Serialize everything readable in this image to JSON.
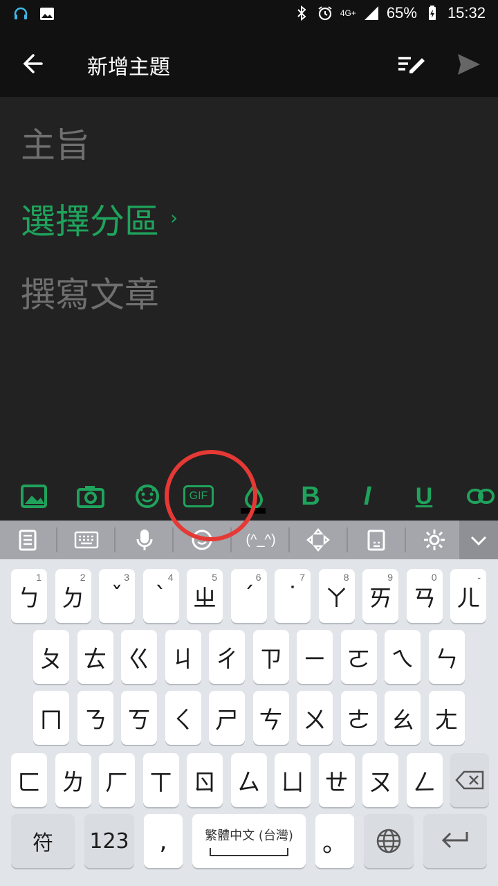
{
  "status_bar": {
    "battery": "65%",
    "time": "15:32",
    "network": "4G+"
  },
  "app_bar": {
    "title": "新增主題"
  },
  "content": {
    "subject_placeholder": "主旨",
    "section_label": "選擇分區",
    "section_chevron": "›",
    "compose_placeholder": "撰寫文章"
  },
  "toolbar": {
    "gif_label": "GIF",
    "bold_label": "B",
    "italic_label": "I",
    "underline_label": "U"
  },
  "keyboard_top": {
    "kaomoji_label": "(^_^)"
  },
  "keyboard": {
    "row1": [
      {
        "char": "ㄅ",
        "hint": "1"
      },
      {
        "char": "ㄉ",
        "hint": "2"
      },
      {
        "char": "ˇ",
        "hint": "3"
      },
      {
        "char": "ˋ",
        "hint": "4"
      },
      {
        "char": "ㄓ",
        "hint": "5"
      },
      {
        "char": "ˊ",
        "hint": "6"
      },
      {
        "char": "˙",
        "hint": "7"
      },
      {
        "char": "ㄚ",
        "hint": "8"
      },
      {
        "char": "ㄞ",
        "hint": "9"
      },
      {
        "char": "ㄢ",
        "hint": "0"
      },
      {
        "char": "ㄦ",
        "hint": "-"
      }
    ],
    "row2": [
      "ㄆ",
      "ㄊ",
      "ㄍ",
      "ㄐ",
      "ㄔ",
      "ㄗ",
      "ㄧ",
      "ㄛ",
      "ㄟ",
      "ㄣ"
    ],
    "row3": [
      "ㄇ",
      "ㄋ",
      "ㄎ",
      "ㄑ",
      "ㄕ",
      "ㄘ",
      "ㄨ",
      "ㄜ",
      "ㄠ",
      "ㄤ"
    ],
    "row4": [
      "ㄈ",
      "ㄌ",
      "ㄏ",
      "ㄒ",
      "ㄖ",
      "ㄙ",
      "ㄩ",
      "ㄝ",
      "ㄡ",
      "ㄥ"
    ],
    "bottom": {
      "symbols": "符",
      "numbers": "123",
      "comma": ",",
      "space_label": "繁體中文 (台灣)",
      "period": "。"
    }
  }
}
